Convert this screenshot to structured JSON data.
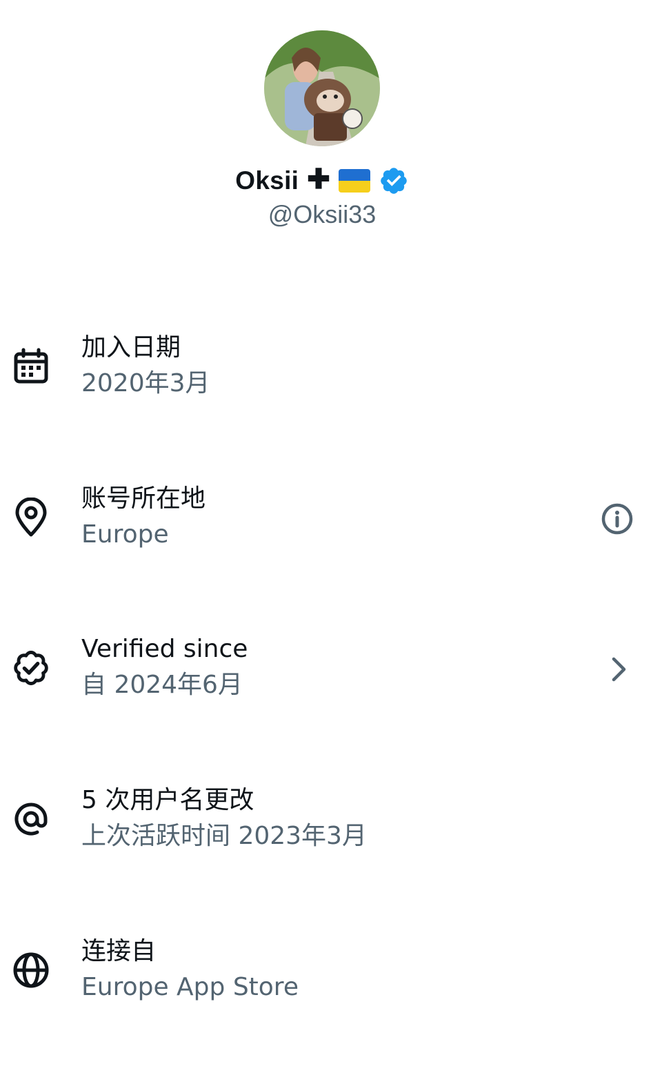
{
  "profile": {
    "display_name": "Oksii",
    "plus_glyph": "✚",
    "handle": "@Oksii33",
    "flag_icon": "ukraine-flag-icon",
    "verified_badge_icon": "verified-badge-icon",
    "verified_badge_color": "#1d9bf0"
  },
  "details": [
    {
      "icon": "calendar-icon",
      "title": "加入日期",
      "value": "2020年3月"
    },
    {
      "icon": "location-pin-icon",
      "title": "账号所在地",
      "value": "Europe",
      "trailing_icon": "info-icon"
    },
    {
      "icon": "verified-seal-icon",
      "title": "Verified since",
      "value": "自 2024年6月",
      "trailing_icon": "chevron-right-icon"
    },
    {
      "icon": "at-sign-icon",
      "title": "5 次用户名更改",
      "value": "上次活跃时间 2023年3月"
    },
    {
      "icon": "globe-icon",
      "title": "连接自",
      "value": "Europe App Store"
    }
  ],
  "colors": {
    "primary_text": "#0f1419",
    "secondary_text": "#536471",
    "background": "#ffffff"
  }
}
